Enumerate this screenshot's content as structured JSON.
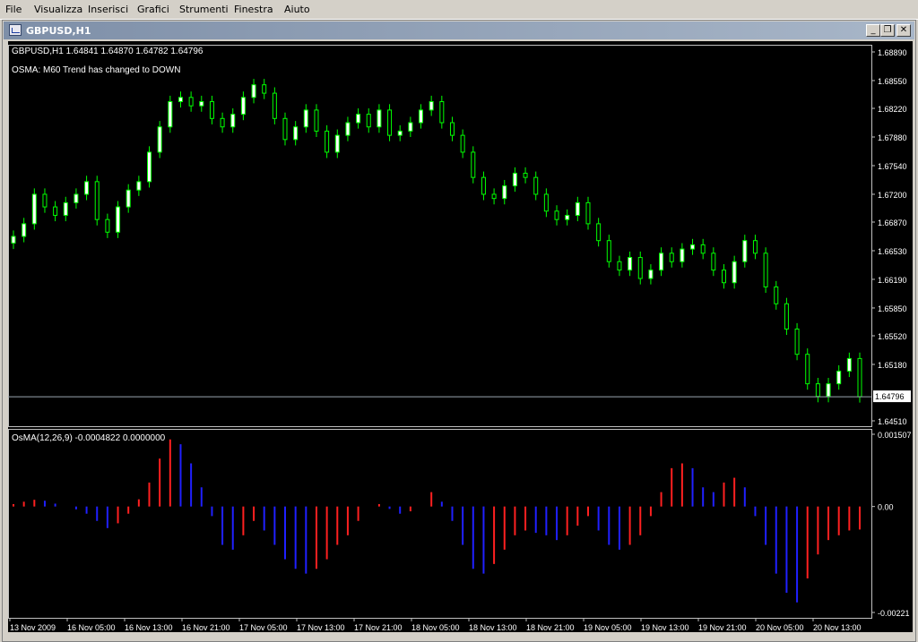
{
  "menu": [
    "File",
    "Visualizza",
    "Inserisci",
    "Grafici",
    "Strumenti",
    "Finestra",
    "Aiuto"
  ],
  "window": {
    "title": "GBPUSD,H1",
    "minimize_icon": "minimize-icon",
    "restore_icon": "restore-icon",
    "close_icon": "close-icon"
  },
  "colors": {
    "background": "#000000",
    "bull": "#ffffff",
    "bear": "#000000",
    "wick": "#00ff00",
    "text": "#ffffff",
    "hist_up": "#ff2020",
    "hist_down": "#2020ff"
  },
  "price_header": "GBPUSD,H1  1.64841 1.64870 1.64782 1.64796",
  "alert_text": "OSMA: M60 Trend has changed to DOWN",
  "indicator_header": "OsMA(12,26,9) -0.0004822 0.0000000",
  "current_price_label": "1.64796",
  "chart_data": [
    {
      "type": "candlestick",
      "symbol": "GBPUSD",
      "timeframe": "H1",
      "ylim": [
        1.6451,
        1.6889
      ],
      "y_ticks": [
        "1.68890",
        "1.68550",
        "1.68220",
        "1.67880",
        "1.67540",
        "1.67200",
        "1.66870",
        "1.66530",
        "1.66190",
        "1.65850",
        "1.65520",
        "1.65180",
        "1.64510"
      ],
      "current_price": 1.64796,
      "x_tick_labels": [
        "13 Nov 2009",
        "16 Nov 05:00",
        "16 Nov 13:00",
        "16 Nov 21:00",
        "17 Nov 05:00",
        "17 Nov 13:00",
        "17 Nov 21:00",
        "18 Nov 05:00",
        "18 Nov 13:00",
        "18 Nov 21:00",
        "19 Nov 05:00",
        "19 Nov 13:00",
        "19 Nov 21:00",
        "20 Nov 05:00",
        "20 Nov 13:00"
      ],
      "close": [
        1.667,
        1.6685,
        1.672,
        1.6705,
        1.6695,
        1.671,
        1.672,
        1.6735,
        1.669,
        1.6675,
        1.6705,
        1.6725,
        1.6735,
        1.677,
        1.68,
        1.683,
        1.6835,
        1.6825,
        1.683,
        1.681,
        1.68,
        1.6815,
        1.6835,
        1.685,
        1.684,
        1.681,
        1.6785,
        1.68,
        1.682,
        1.6795,
        1.677,
        1.679,
        1.6805,
        1.6815,
        1.68,
        1.682,
        1.679,
        1.6795,
        1.6805,
        1.682,
        1.683,
        1.6805,
        1.679,
        1.677,
        1.674,
        1.672,
        1.6715,
        1.673,
        1.6745,
        1.674,
        1.672,
        1.67,
        1.669,
        1.6695,
        1.671,
        1.6685,
        1.6665,
        1.664,
        1.663,
        1.6645,
        1.662,
        1.663,
        1.665,
        1.664,
        1.6655,
        1.666,
        1.665,
        1.663,
        1.6615,
        1.664,
        1.6665,
        1.665,
        1.661,
        1.659,
        1.656,
        1.653,
        1.6495,
        1.648,
        1.6495,
        1.651,
        1.6525,
        1.64796
      ],
      "highs_lows_note": "",
      "indicator": {
        "name": "OsMA(12,26,9)",
        "value": -0.0004822,
        "signal": 0.0,
        "ylim": [
          -0.00221,
          0.001507
        ],
        "y_ticks": [
          "0.001507",
          "0.00",
          "-0.00221"
        ],
        "values": [
          5e-05,
          0.0001,
          0.00014,
          0.00012,
          6e-05,
          0.0,
          -6e-05,
          -0.00015,
          -0.0003,
          -0.00045,
          -0.00035,
          -0.00015,
          0.00015,
          0.0005,
          0.001,
          0.0014,
          0.0013,
          0.0009,
          0.0004,
          -0.0002,
          -0.0008,
          -0.0009,
          -0.0006,
          -0.0003,
          -0.0005,
          -0.0008,
          -0.0011,
          -0.0013,
          -0.0014,
          -0.0013,
          -0.0011,
          -0.0008,
          -0.0006,
          -0.0003,
          0.0,
          5e-05,
          -5e-05,
          -0.00015,
          -0.0001,
          0.0,
          0.0003,
          0.0001,
          -0.0003,
          -0.0008,
          -0.0013,
          -0.0014,
          -0.0012,
          -0.0009,
          -0.0006,
          -0.0005,
          -0.00055,
          -0.0006,
          -0.0007,
          -0.0006,
          -0.0004,
          -0.0002,
          -0.0005,
          -0.0008,
          -0.0009,
          -0.0008,
          -0.0006,
          -0.0002,
          0.0003,
          0.0008,
          0.0009,
          0.0008,
          0.0004,
          0.0003,
          0.0005,
          0.0006,
          0.0004,
          -0.0002,
          -0.0008,
          -0.0014,
          -0.0018,
          -0.002,
          -0.0015,
          -0.001,
          -0.0007,
          -0.0006,
          -0.0005,
          -0.00048
        ]
      }
    }
  ]
}
